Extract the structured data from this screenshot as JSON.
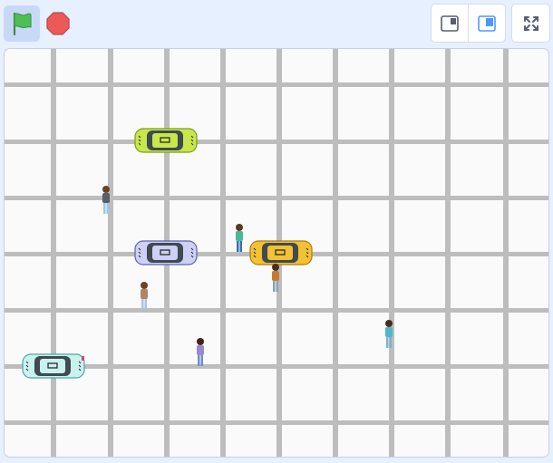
{
  "toolbar": {
    "green_flag": {
      "icon": "green-flag-icon",
      "color": "#4cbf56"
    },
    "stop": {
      "icon": "stop-sign-icon",
      "color": "#ec5959"
    },
    "small_stage": {
      "icon": "small-stage-layout-icon"
    },
    "normal_stage": {
      "icon": "normal-stage-layout-icon",
      "color": "#4c97ff"
    },
    "fullscreen": {
      "icon": "fullscreen-icon"
    }
  },
  "stage": {
    "background": "#fafafa",
    "road_color": "#bdbdbd",
    "sprites": [
      {
        "name": "car-lime",
        "kind": "car",
        "color": "#c8e84a"
      },
      {
        "name": "car-lavender",
        "kind": "car",
        "color": "#cfd0f5"
      },
      {
        "name": "car-yellow",
        "kind": "car",
        "color": "#f2c233"
      },
      {
        "name": "car-aqua",
        "kind": "car",
        "color": "#c9f2ef"
      },
      {
        "name": "pedestrian-1",
        "kind": "person",
        "shirt": "#55606a"
      },
      {
        "name": "pedestrian-2",
        "kind": "person",
        "shirt": "#4ab89a"
      },
      {
        "name": "pedestrian-3",
        "kind": "person",
        "shirt": "#c87a2c"
      },
      {
        "name": "pedestrian-4",
        "kind": "person",
        "shirt": "#b0846a"
      },
      {
        "name": "pedestrian-5",
        "kind": "person",
        "shirt": "#9b86d8"
      },
      {
        "name": "pedestrian-6",
        "kind": "person",
        "shirt": "#4ab8c8"
      }
    ]
  }
}
